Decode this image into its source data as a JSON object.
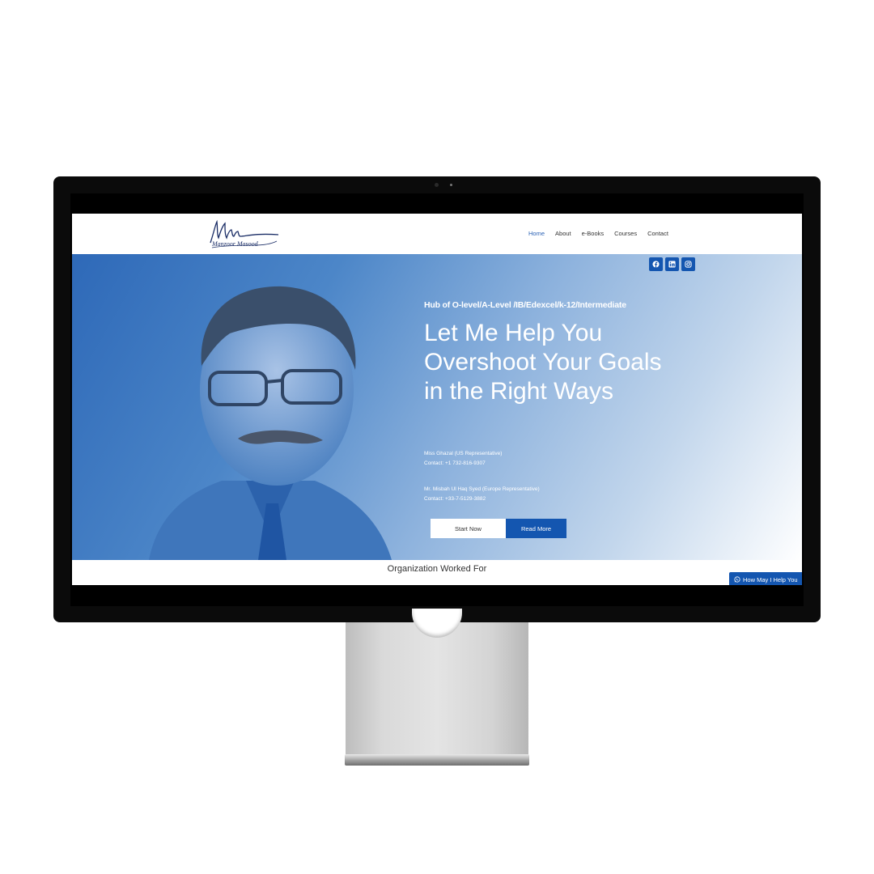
{
  "nav": {
    "items": [
      {
        "label": "Home",
        "active": true
      },
      {
        "label": "About"
      },
      {
        "label": "e-Books"
      },
      {
        "label": "Courses"
      },
      {
        "label": "Contact"
      }
    ]
  },
  "social": [
    "facebook-icon",
    "linkedin-icon",
    "instagram-icon"
  ],
  "hero": {
    "tagline": "Hub of O-level/A-Level /IB/Edexcel/k-12/Intermediate",
    "headline": "Let Me Help You Overshoot Your Goals in the Right Ways",
    "rep1": {
      "name": "Miss Ghazal (US Representative)",
      "contact": "Contact: +1 732-816-9307"
    },
    "rep2": {
      "name": "Mr. Misbah Ul Haq Syed (Europe Representative)",
      "contact": "Contact: +33-7-5129-3882"
    },
    "start_label": "Start Now",
    "read_label": "Read More"
  },
  "org_heading": "Organization Worked For",
  "help_label": "How May I Help You",
  "colors": {
    "accent": "#1456b0",
    "nav_active": "#2c62b5"
  }
}
